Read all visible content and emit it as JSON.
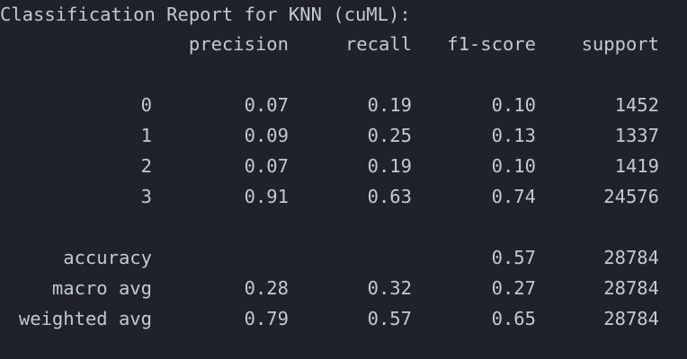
{
  "title": "Classification Report for KNN (cuML):",
  "headers": [
    "precision",
    "recall",
    "f1-score",
    "support"
  ],
  "class_rows": [
    {
      "label": "0",
      "precision": "0.07",
      "recall": "0.19",
      "f1": "0.10",
      "support": "1452"
    },
    {
      "label": "1",
      "precision": "0.09",
      "recall": "0.25",
      "f1": "0.13",
      "support": "1337"
    },
    {
      "label": "2",
      "precision": "0.07",
      "recall": "0.19",
      "f1": "0.10",
      "support": "1419"
    },
    {
      "label": "3",
      "precision": "0.91",
      "recall": "0.63",
      "f1": "0.74",
      "support": "24576"
    }
  ],
  "summary_rows": [
    {
      "label": "accuracy",
      "precision": "",
      "recall": "",
      "f1": "0.57",
      "support": "28784"
    },
    {
      "label": "macro avg",
      "precision": "0.28",
      "recall": "0.32",
      "f1": "0.27",
      "support": "28784"
    },
    {
      "label": "weighted avg",
      "precision": "0.79",
      "recall": "0.57",
      "f1": "0.65",
      "support": "28784"
    }
  ],
  "colors": {
    "background": "#1f2329",
    "text": "#c3c9d1"
  }
}
